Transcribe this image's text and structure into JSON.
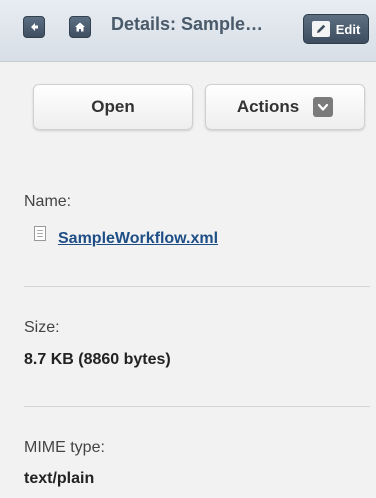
{
  "header": {
    "title": "Details: Sample…",
    "edit_label": "Edit",
    "back_icon": "back-icon",
    "home_icon": "home-icon",
    "edit_icon": "pencil-icon"
  },
  "actions": {
    "open_label": "Open",
    "actions_label": "Actions"
  },
  "details": {
    "name_label": "Name:",
    "file_name": "SampleWorkflow.xml",
    "size_label": "Size:",
    "size_value": "8.7 KB (8860 bytes)",
    "mime_label": "MIME type:",
    "mime_value": "text/plain"
  },
  "colors": {
    "header_bg": "#dbe2e9",
    "link": "#1e4e86",
    "toolbar_button": "#46576a"
  }
}
